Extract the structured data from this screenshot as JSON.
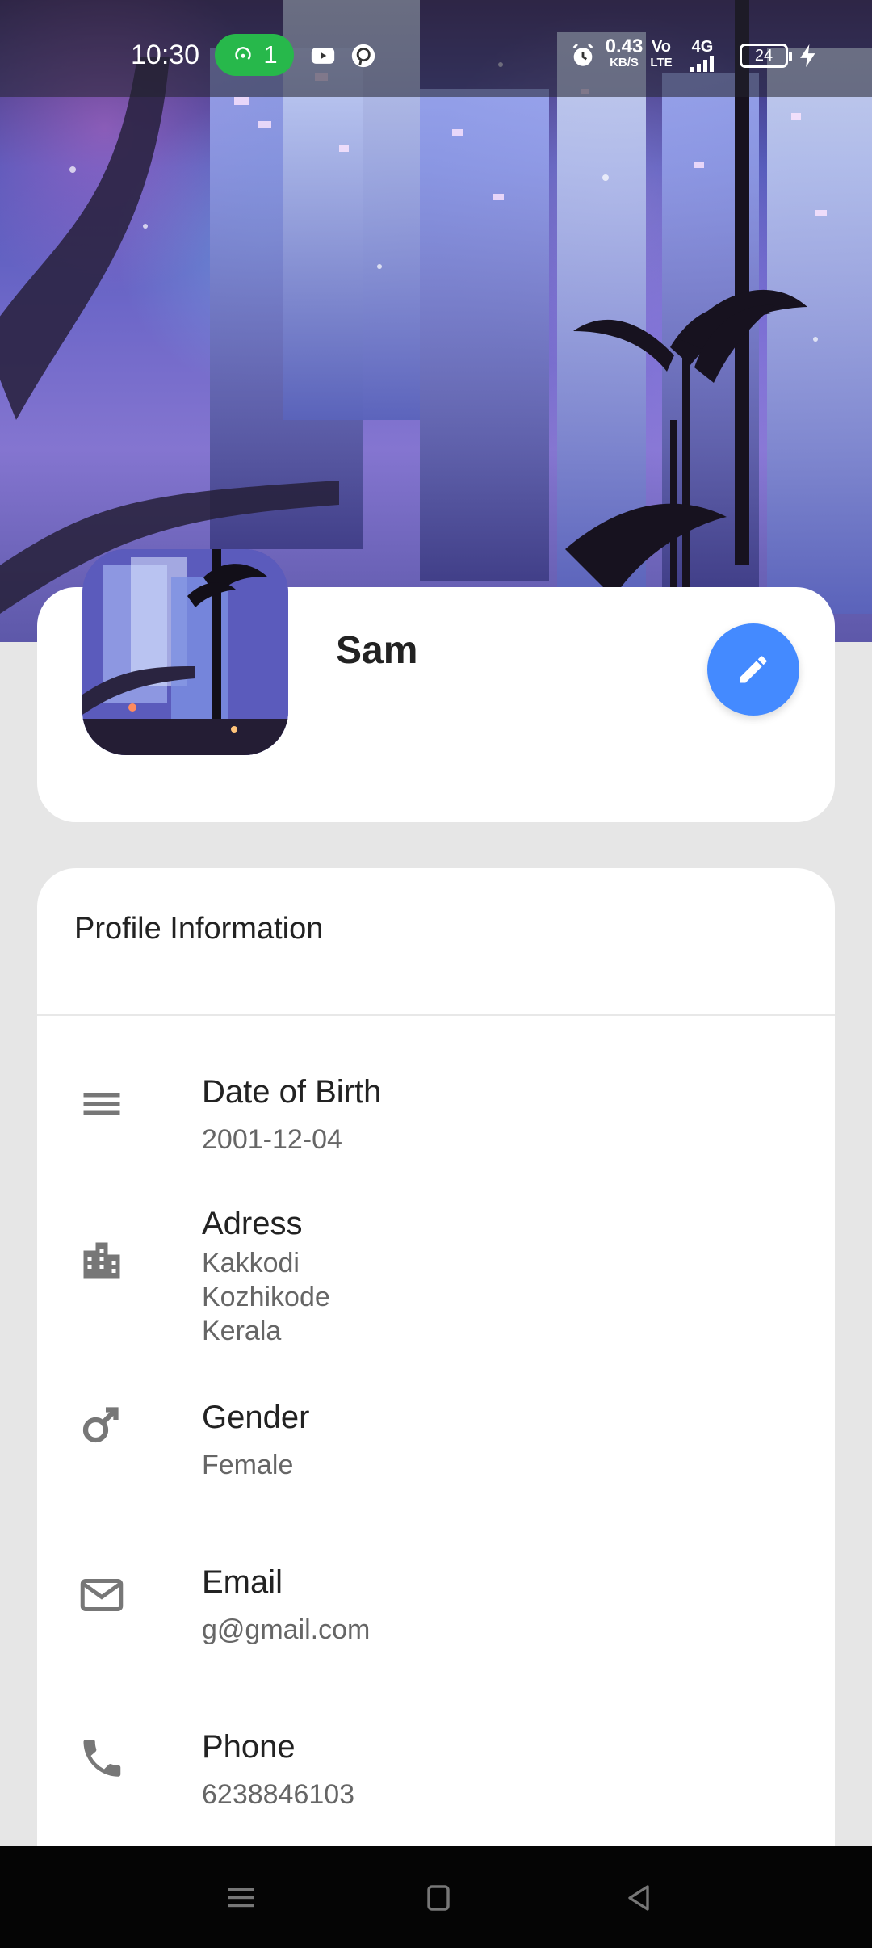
{
  "status_bar": {
    "time": "10:30",
    "hotspot_count": "1",
    "network_speed_value": "0.43",
    "network_speed_unit": "KB/S",
    "volte_top": "Vo",
    "volte_bottom": "LTE",
    "network_type": "4G",
    "battery": "24"
  },
  "profile": {
    "name": "Sam"
  },
  "info": {
    "title": "Profile Information",
    "rows": [
      {
        "label": "Date of Birth",
        "value": "2001-12-04"
      },
      {
        "label": "Adress",
        "value_lines": [
          "Kakkodi",
          "Kozhikode",
          "Kerala"
        ]
      },
      {
        "label": "Gender",
        "value": "Female"
      },
      {
        "label": "Email",
        "value": "g@gmail.com"
      },
      {
        "label": "Phone",
        "value": "6238846103"
      }
    ]
  },
  "icons": {
    "hotspot": "hotspot-icon",
    "youtube": "youtube-icon",
    "pinterest": "pinterest-icon",
    "alarm": "alarm-icon",
    "signal": "signal-icon",
    "charging": "charging-icon",
    "edit": "pencil-icon",
    "date": "menu-lines-icon",
    "address": "building-icon",
    "gender": "male-symbol-icon",
    "email": "mail-icon",
    "phone": "phone-icon",
    "nav_menu": "menu-icon",
    "nav_home": "square-icon",
    "nav_back": "back-triangle-icon"
  },
  "colors": {
    "fab": "#448aff",
    "hotspot_badge": "#27b84b",
    "background": "#e6e6e6",
    "card": "#ffffff"
  }
}
